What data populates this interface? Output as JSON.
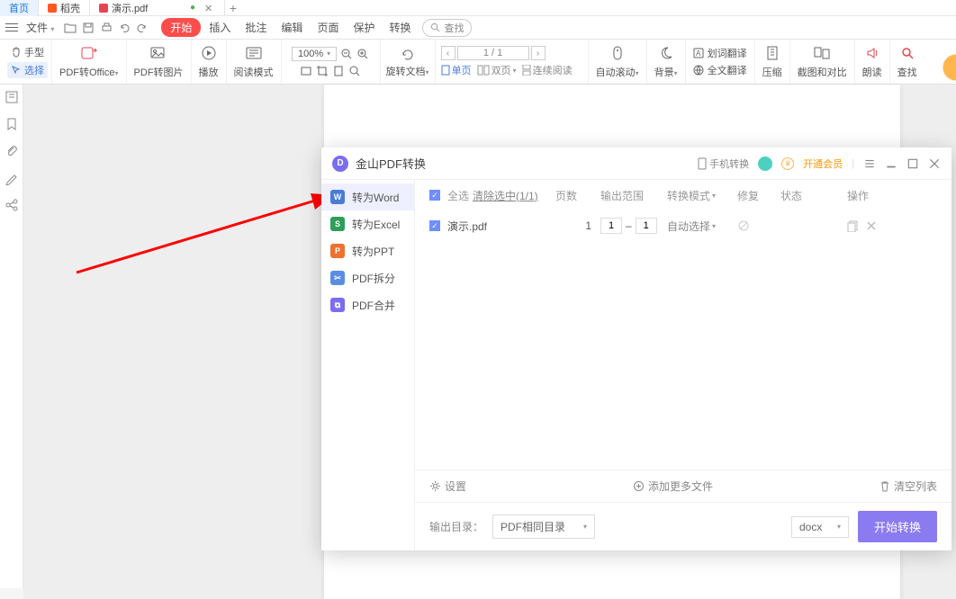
{
  "tabs": {
    "home": "首页",
    "shell": "稻壳",
    "file": "演示.pdf"
  },
  "menu": {
    "file": "文件",
    "start": "开始",
    "insert": "插入",
    "annotate": "批注",
    "edit": "编辑",
    "page": "页面",
    "protect": "保护",
    "convert": "转换",
    "search": "查找"
  },
  "ribbon": {
    "hand": "手型",
    "select": "选择",
    "pdf_office": "PDF转Office",
    "pdf_image": "PDF转图片",
    "play": "播放",
    "read_mode": "阅读模式",
    "zoom": "100%",
    "rotate": "旋转文档",
    "single": "单页",
    "double": "双页",
    "continuous": "连续阅读",
    "page_disp": "1 / 1",
    "auto_scroll": "自动滚动",
    "background": "背景",
    "word_trans": "划词翻译",
    "full_trans": "全文翻译",
    "compress": "压缩",
    "screenshot": "截图和对比",
    "read_aloud": "朗读",
    "find": "查找"
  },
  "dialog": {
    "title": "金山PDF转换",
    "phone_convert": "手机转换",
    "open_vip": "开通会员",
    "side": {
      "word": "转为Word",
      "excel": "转为Excel",
      "ppt": "转为PPT",
      "split": "PDF拆分",
      "merge": "PDF合并"
    },
    "header": {
      "all": "全选",
      "clear": "清除选中(1/1)",
      "pages": "页数",
      "range": "输出范围",
      "mode": "转换模式",
      "fix": "修复",
      "status": "状态",
      "ops": "操作"
    },
    "row": {
      "name": "演示.pdf",
      "pages": "1",
      "r1": "1",
      "r2": "1",
      "mode": "自动选择"
    },
    "mid": {
      "settings": "设置",
      "add_more": "添加更多文件",
      "clear_list": "清空列表"
    },
    "bottom": {
      "out_label": "输出目录：",
      "out_dir": "PDF相同目录",
      "fmt": "docx",
      "start": "开始转换"
    }
  }
}
